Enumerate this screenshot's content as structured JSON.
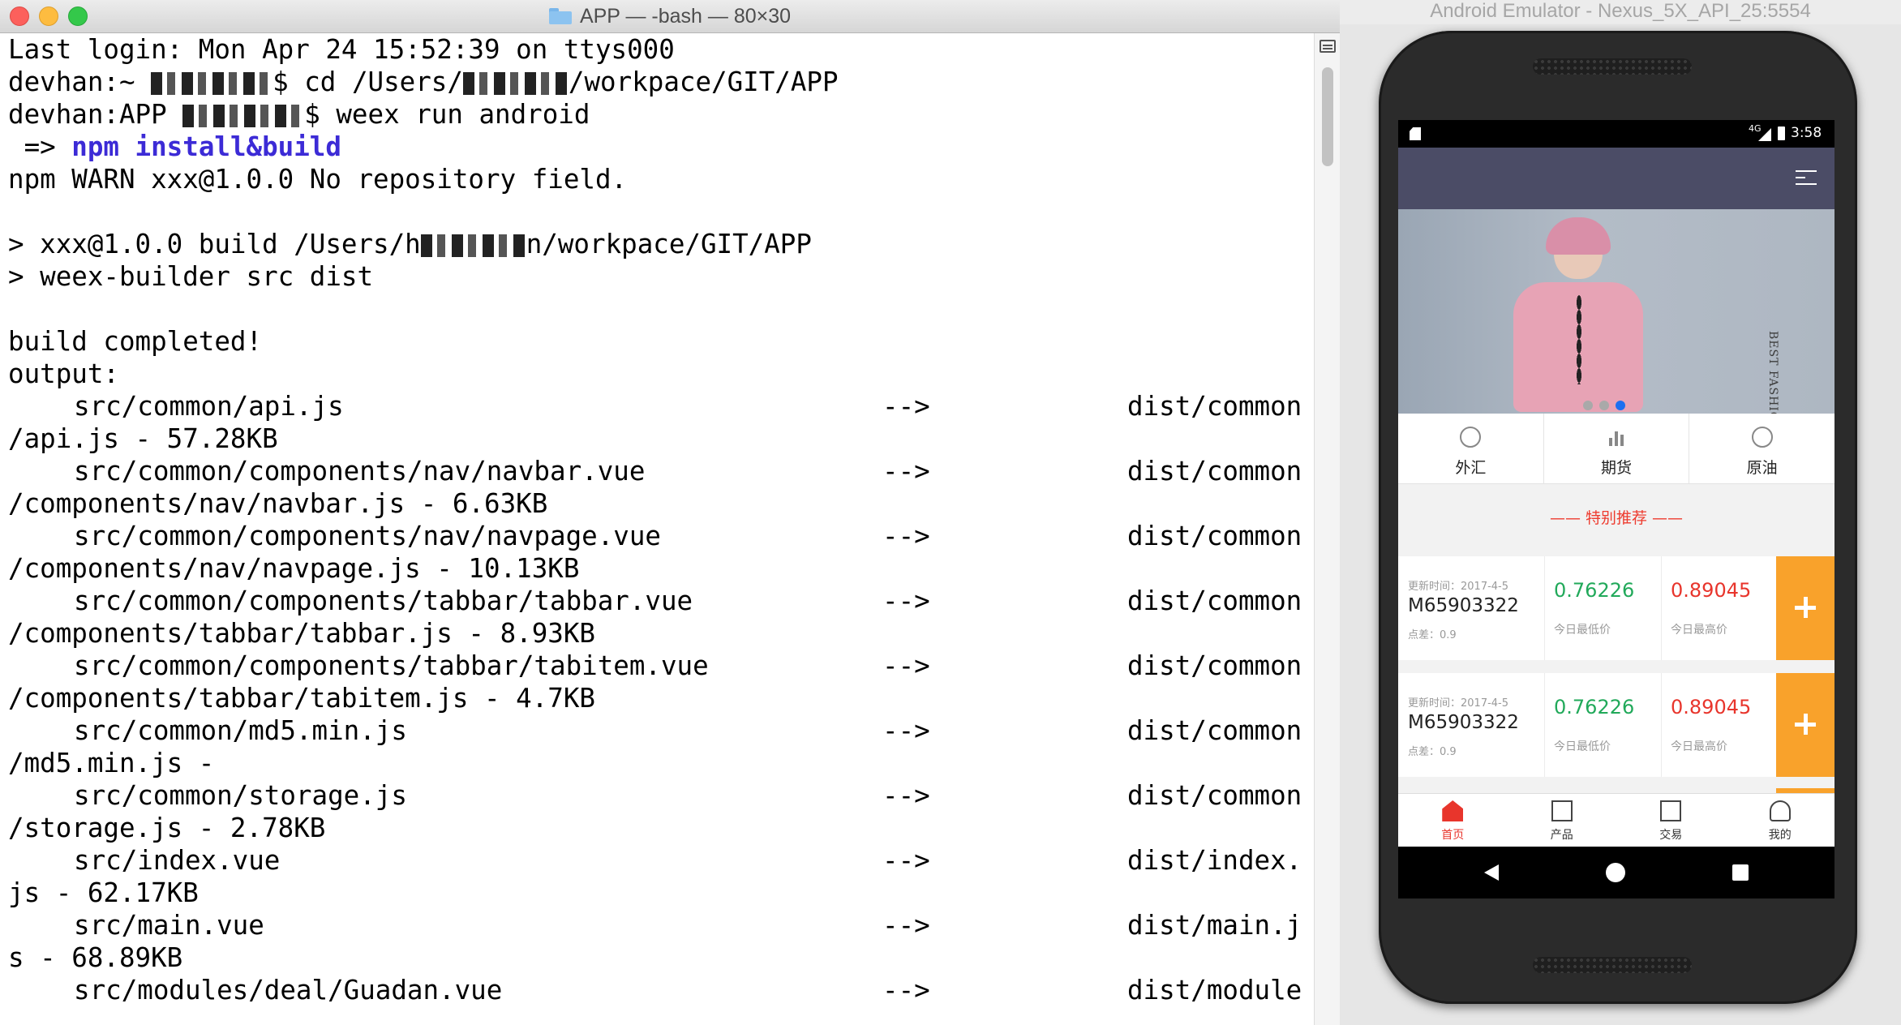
{
  "terminal": {
    "title": "APP — -bash — 80×30",
    "lines": {
      "l1": "Last login: Mon Apr 24 15:52:39 on ttys000",
      "l2_prefix": "devhan:~ ",
      "l2_suffix": "$ cd /Users/",
      "l2_end": "/workpace/GIT/APP",
      "l3_prefix": "devhan:APP ",
      "l3_suffix": "$ weex run android",
      "l4_arrow": " => ",
      "l4_cmd": "npm install&build",
      "l5": "npm WARN xxx@1.0.0 No repository field.",
      "l7_prefix": "> xxx@1.0.0 build /Users/h",
      "l7_suffix": "n/workpace/GIT/APP",
      "l8": "> weex-builder src dist",
      "l10": "build completed!",
      "l11": "output:"
    },
    "outputs": [
      {
        "src": "src/common/api.js",
        "arrow": "-->",
        "dest": "dist/common",
        "cont": "/api.js - 57.28KB"
      },
      {
        "src": "src/common/components/nav/navbar.vue",
        "arrow": "-->",
        "dest": "dist/common",
        "cont": "/components/nav/navbar.js - 6.63KB"
      },
      {
        "src": "src/common/components/nav/navpage.vue",
        "arrow": "-->",
        "dest": "dist/common",
        "cont": "/components/nav/navpage.js - 10.13KB"
      },
      {
        "src": "src/common/components/tabbar/tabbar.vue",
        "arrow": "-->",
        "dest": "dist/common",
        "cont": "/components/tabbar/tabbar.js - 8.93KB"
      },
      {
        "src": "src/common/components/tabbar/tabitem.vue",
        "arrow": "-->",
        "dest": "dist/common",
        "cont": "/components/tabbar/tabitem.js - 4.7KB"
      },
      {
        "src": "src/common/md5.min.js",
        "arrow": "-->",
        "dest": "dist/common",
        "cont": "/md5.min.js -"
      },
      {
        "src": "src/common/storage.js",
        "arrow": "-->",
        "dest": "dist/common",
        "cont": "/storage.js - 2.78KB"
      },
      {
        "src": "src/index.vue",
        "arrow": "-->",
        "dest": "dist/index.",
        "cont": "js - 62.17KB"
      },
      {
        "src": "src/main.vue",
        "arrow": "-->",
        "dest": "dist/main.j",
        "cont": "s - 68.89KB"
      },
      {
        "src": "src/modules/deal/Guadan.vue",
        "arrow": "-->",
        "dest": "dist/module",
        "cont": ""
      }
    ]
  },
  "emulator": {
    "title": "Android Emulator - Nexus_5X_API_25:5554",
    "status": {
      "network": "4G",
      "time": "3:58"
    },
    "banner": {
      "text": "BEST FASHION Womens"
    },
    "categories": [
      {
        "label": "外汇",
        "icon": "dollar-circle-icon"
      },
      {
        "label": "期货",
        "icon": "bar-chart-icon"
      },
      {
        "label": "原油",
        "icon": "wave-circle-icon"
      }
    ],
    "recommend_title": "—— 特别推荐 ——",
    "products": [
      {
        "time": "更新时间：2017-4-5",
        "name": "M65903322",
        "diff": "点差：0.9",
        "low": "0.76226",
        "low_label": "今日最低价",
        "high": "0.89045",
        "high_label": "今日最高价"
      },
      {
        "time": "更新时间：2017-4-5",
        "name": "M65903322",
        "diff": "点差：0.9",
        "low": "0.76226",
        "low_label": "今日最低价",
        "high": "0.89045",
        "high_label": "今日最高价"
      }
    ],
    "tabs": [
      {
        "label": "首页",
        "icon": "home-icon"
      },
      {
        "label": "产品",
        "icon": "list-icon"
      },
      {
        "label": "交易",
        "icon": "cart-icon"
      },
      {
        "label": "我的",
        "icon": "user-icon"
      }
    ],
    "colors": {
      "accent_orange": "#f9a22b",
      "low_green": "#21a95a",
      "high_red": "#e8352c",
      "header": "#4b4c66"
    }
  }
}
